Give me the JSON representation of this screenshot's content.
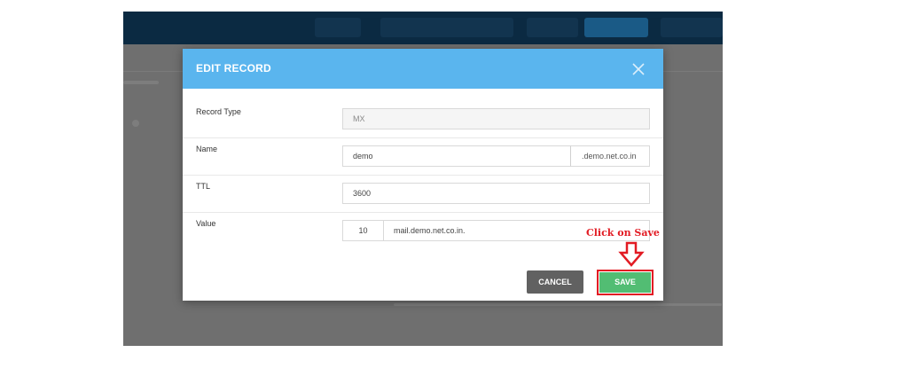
{
  "modal": {
    "title": "EDIT RECORD",
    "fields": {
      "record_type": {
        "label": "Record Type",
        "value": "MX"
      },
      "name": {
        "label": "Name",
        "value": "demo",
        "suffix": ".demo.net.co.in"
      },
      "ttl": {
        "label": "TTL",
        "value": "3600"
      },
      "value": {
        "label": "Value",
        "priority": "10",
        "target": "mail.demo.net.co.in."
      }
    },
    "buttons": {
      "cancel": "CANCEL",
      "save": "SAVE"
    }
  },
  "annotation": {
    "text": "Click on Save",
    "color": "#e21b23"
  },
  "colors": {
    "header": "#5ab5ee",
    "save": "#52bd73",
    "cancel": "#616161",
    "overlay": "#6f6f6f",
    "topbar": "#0b2a42"
  }
}
